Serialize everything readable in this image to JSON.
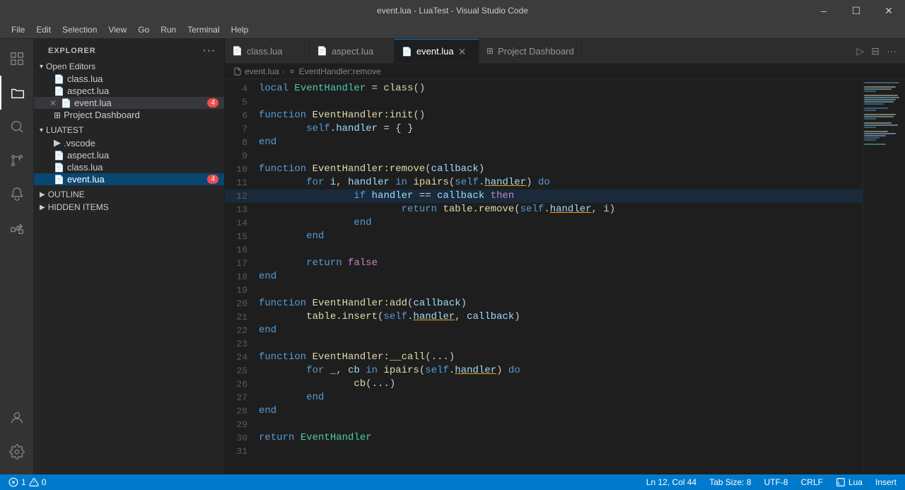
{
  "titleBar": {
    "title": "event.lua - LuaTest - Visual Studio Code",
    "minimize": "🗕",
    "maximize": "🗗",
    "close": "✕"
  },
  "menuBar": {
    "items": [
      "File",
      "Edit",
      "Selection",
      "View",
      "Go",
      "Run",
      "Terminal",
      "Help"
    ]
  },
  "sidebar": {
    "header": "Explorer",
    "moreLabel": "···",
    "sections": {
      "openEditors": {
        "label": "Open Editors",
        "files": [
          {
            "name": "class.lua",
            "icon": "📄",
            "color": "#cccccc",
            "badge": null,
            "hasClose": false,
            "prefix": ""
          },
          {
            "name": "aspect.lua",
            "icon": "📄",
            "color": "#cccccc",
            "badge": null,
            "hasClose": false,
            "prefix": ""
          },
          {
            "name": "event.lua",
            "icon": "📄",
            "color": "#cccccc",
            "badge": "4",
            "hasClose": true,
            "prefix": ""
          },
          {
            "name": "Project Dashboard",
            "icon": "⊞",
            "color": "#cccccc",
            "badge": null,
            "hasClose": false,
            "prefix": ""
          }
        ]
      },
      "luatest": {
        "label": "LUATEST",
        "items": [
          {
            "name": ".vscode",
            "icon": "📁",
            "indent": 12,
            "badge": null
          },
          {
            "name": "aspect.lua",
            "icon": "📄",
            "indent": 12,
            "badge": null
          },
          {
            "name": "class.lua",
            "icon": "📄",
            "indent": 12,
            "badge": null
          },
          {
            "name": "event.lua",
            "icon": "📄",
            "indent": 12,
            "badge": "4"
          }
        ]
      }
    }
  },
  "tabs": [
    {
      "name": "class.lua",
      "icon": "📄",
      "active": false,
      "modified": false
    },
    {
      "name": "aspect.lua",
      "icon": "📄",
      "active": false,
      "modified": false
    },
    {
      "name": "event.lua",
      "icon": "📄",
      "active": true,
      "modified": true
    },
    {
      "name": "Project Dashboard",
      "icon": "⊞",
      "active": false,
      "modified": false
    }
  ],
  "breadcrumb": {
    "file": "event.lua",
    "symbol": "EventHandler:remove"
  },
  "code": {
    "lines": [
      {
        "num": 4,
        "content": "local EventHandler = class()"
      },
      {
        "num": 5,
        "content": ""
      },
      {
        "num": 6,
        "content": "function EventHandler:init()"
      },
      {
        "num": 7,
        "content": "        self.handler = { }"
      },
      {
        "num": 8,
        "content": "end"
      },
      {
        "num": 9,
        "content": ""
      },
      {
        "num": 10,
        "content": "function EventHandler:remove(callback)"
      },
      {
        "num": 11,
        "content": "        for i, handler in ipairs(self.handler) do"
      },
      {
        "num": 12,
        "content": "                if handler == callback then"
      },
      {
        "num": 13,
        "content": "                        return table.remove(self.handler, i)"
      },
      {
        "num": 14,
        "content": "                end"
      },
      {
        "num": 15,
        "content": "        end"
      },
      {
        "num": 16,
        "content": ""
      },
      {
        "num": 17,
        "content": "        return false"
      },
      {
        "num": 18,
        "content": "end"
      },
      {
        "num": 19,
        "content": ""
      },
      {
        "num": 20,
        "content": "function EventHandler:add(callback)"
      },
      {
        "num": 21,
        "content": "        table.insert(self.handler, callback)"
      },
      {
        "num": 22,
        "content": "end"
      },
      {
        "num": 23,
        "content": ""
      },
      {
        "num": 24,
        "content": "function EventHandler:__call(...)"
      },
      {
        "num": 25,
        "content": "        for _, cb in ipairs(self.handler) do"
      },
      {
        "num": 26,
        "content": "                cb(...)"
      },
      {
        "num": 27,
        "content": "        end"
      },
      {
        "num": 28,
        "content": "end"
      },
      {
        "num": 29,
        "content": ""
      },
      {
        "num": 30,
        "content": "return EventHandler"
      },
      {
        "num": 31,
        "content": ""
      }
    ]
  },
  "statusBar": {
    "errorCount": "1",
    "warningCount": "0",
    "branch": "Ln 12, Col 44",
    "tabSize": "Tab Size: 8",
    "encoding": "UTF-8",
    "lineEnding": "CRLF",
    "language": "Lua",
    "insert": "Insert"
  }
}
